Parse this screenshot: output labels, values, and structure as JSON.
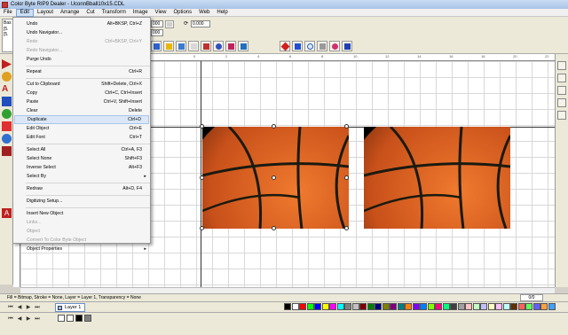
{
  "window": {
    "title": "Color Byte RIP9 Dealer - UconnBball10x15.CDL"
  },
  "menubar": {
    "items": [
      "File",
      "Edit",
      "Layout",
      "Arrange",
      "Cut",
      "Transform",
      "Image",
      "View",
      "Options",
      "Web",
      "Help"
    ],
    "active": "Edit"
  },
  "toolbar": {
    "field1": "000",
    "field2": "000",
    "angle": "0.000",
    "left_label1": "Bas",
    "left_label2": "[5.",
    "left_label3": "[5."
  },
  "ruler": {
    "labels": [
      "0",
      "2",
      "4",
      "6",
      "8",
      "10",
      "12",
      "14",
      "16",
      "18",
      "20",
      "22"
    ]
  },
  "edit_menu": {
    "items": [
      {
        "label": "Undo",
        "shortcut": "Alt+BKSP, Ctrl+Z",
        "disabled": false
      },
      {
        "label": "Undo Navigator...",
        "shortcut": "",
        "disabled": false
      },
      {
        "label": "Redo",
        "shortcut": "Ctrl+BKSP, Ctrl+Y",
        "disabled": true
      },
      {
        "label": "Redo Navigator...",
        "shortcut": "",
        "disabled": true
      },
      {
        "label": "Purge Undo",
        "shortcut": "",
        "disabled": false
      },
      {
        "label": "Repeat",
        "shortcut": "Ctrl+R",
        "disabled": false
      },
      {
        "label": "Cut to Clipboard",
        "shortcut": "Shift+Delete, Ctrl+X",
        "disabled": false
      },
      {
        "label": "Copy",
        "shortcut": "Ctrl+C, Ctrl+Insert",
        "disabled": false
      },
      {
        "label": "Paste",
        "shortcut": "Ctrl+V, Shift+Insert",
        "disabled": false
      },
      {
        "label": "Clear",
        "shortcut": "Delete",
        "disabled": false
      },
      {
        "label": "Duplicate",
        "shortcut": "Ctrl+D",
        "disabled": false
      },
      {
        "label": "Edit Object",
        "shortcut": "Ctrl+E",
        "disabled": false
      },
      {
        "label": "Edit Font",
        "shortcut": "Ctrl+T",
        "disabled": false
      },
      {
        "label": "Select All",
        "shortcut": "Ctrl+A, F3",
        "disabled": false
      },
      {
        "label": "Select None",
        "shortcut": "Shift+F3",
        "disabled": false
      },
      {
        "label": "Inverse Select",
        "shortcut": "Alt+F3",
        "disabled": false
      },
      {
        "label": "Select By",
        "shortcut": "",
        "disabled": false
      },
      {
        "label": "Redraw",
        "shortcut": "Alt+D, F4",
        "disabled": false
      },
      {
        "label": "Digitizing Setup...",
        "shortcut": "",
        "disabled": false
      },
      {
        "label": "Insert New Object",
        "shortcut": "",
        "disabled": false
      },
      {
        "label": "Links...",
        "shortcut": "",
        "disabled": true
      },
      {
        "label": "Object",
        "shortcut": "",
        "disabled": true
      },
      {
        "label": "Convert To Color Byte Object",
        "shortcut": "",
        "disabled": true
      },
      {
        "label": "Object Properties",
        "shortcut": "",
        "disabled": false
      }
    ],
    "highlighted": "Duplicate"
  },
  "status": {
    "text": "Fill = Bitmap, Stroke = None, Layer = Layer 1, Transparency = None",
    "page": "0/0"
  },
  "layer": {
    "name": "Layer 1"
  },
  "colors": {
    "accent": "#cde0f7",
    "ball_orange": "#d4581c",
    "palette": [
      "#000000",
      "#ffffff",
      "#ff0000",
      "#00ff00",
      "#0000ff",
      "#ffff00",
      "#ff00ff",
      "#00ffff",
      "#808080",
      "#c0c0c0",
      "#800000",
      "#008000",
      "#000080",
      "#808000",
      "#800080",
      "#008080",
      "#ff8000",
      "#8000ff",
      "#0080ff",
      "#80ff00",
      "#ff0080",
      "#00ff80",
      "#404040",
      "#a0a0a0",
      "#ffc0c0",
      "#c0ffc0",
      "#c0c0ff",
      "#ffffc0",
      "#ffc0ff",
      "#c0ffff",
      "#603000",
      "#ff6060",
      "#60ff60",
      "#6060ff",
      "#ffa040",
      "#40a0ff"
    ]
  }
}
